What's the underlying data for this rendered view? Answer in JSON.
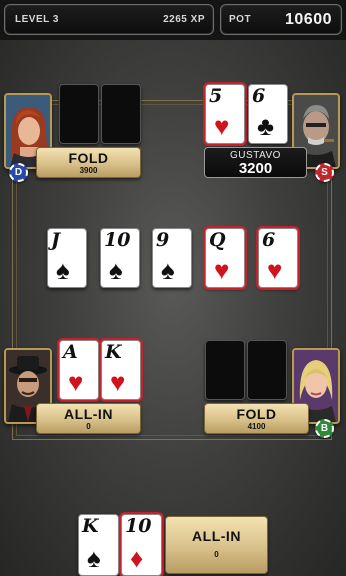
{
  "header": {
    "level": "LEVEL 3",
    "xp": "2265 XP",
    "pot_label": "POT",
    "pot_value": "10600"
  },
  "players": {
    "top_left": {
      "action": "FOLD",
      "amount": "3900",
      "chip": "D",
      "chip_color": "#2a4aa8"
    },
    "top_right": {
      "name": "GUSTAVO",
      "chips": "3200",
      "chip": "S",
      "chip_color": "#c0272d",
      "cards": [
        {
          "rank": "5",
          "suit": "♥"
        },
        {
          "rank": "6",
          "suit": "♣"
        }
      ]
    },
    "bottom_left": {
      "action": "ALL-IN",
      "amount": "0",
      "cards": [
        {
          "rank": "A",
          "suit": "♥"
        },
        {
          "rank": "K",
          "suit": "♥"
        }
      ]
    },
    "bottom_right": {
      "action": "FOLD",
      "amount": "4100",
      "chip": "B",
      "chip_color": "#2e8a3a"
    },
    "hero": {
      "action": "ALL-IN",
      "amount": "0",
      "cards": [
        {
          "rank": "K",
          "suit": "♠"
        },
        {
          "rank": "10",
          "suit": "♦"
        }
      ]
    }
  },
  "board": [
    {
      "rank": "J",
      "suit": "♠"
    },
    {
      "rank": "10",
      "suit": "♠"
    },
    {
      "rank": "9",
      "suit": "♠"
    },
    {
      "rank": "Q",
      "suit": "♥"
    },
    {
      "rank": "6",
      "suit": "♥"
    }
  ]
}
